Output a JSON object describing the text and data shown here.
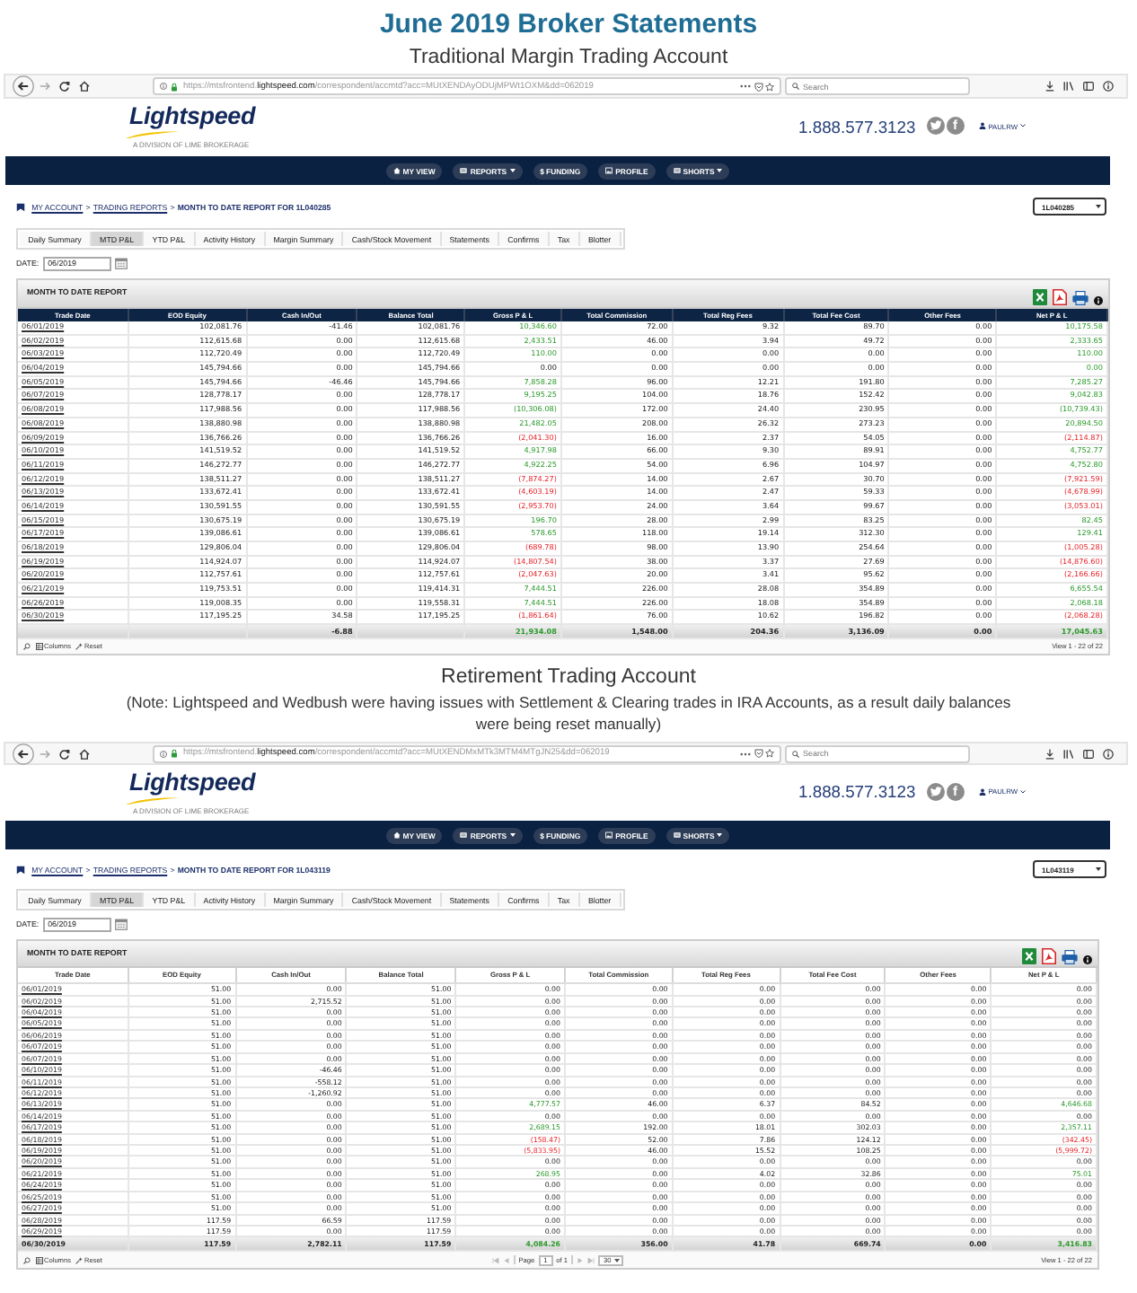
{
  "page_title": "June 2019 Broker Statements",
  "sections": [
    {
      "heading": "Traditional Margin Trading Account",
      "browser": {
        "url": "https://mtsfrontend.**lightspeed.com**/correspondent/accmtd?acc=MUtXENDAyODUjMPWt1OXM&dd=062019",
        "search_placeholder": "Search"
      },
      "site": {
        "logo": "Lightspeed",
        "tagline": "A DIVISION OF LIME BROKERAGE",
        "phone": "1.888.577.3123",
        "social_letter": "f",
        "user": "PAULRW"
      },
      "nav": [
        {
          "label": "MY VIEW",
          "kind": "home",
          "dropdown": false
        },
        {
          "label": "REPORTS",
          "kind": "card",
          "dropdown": true
        },
        {
          "label": "$ FUNDING",
          "kind": "plain",
          "dropdown": false
        },
        {
          "label": "PROFILE",
          "kind": "picture",
          "dropdown": false
        },
        {
          "label": "SHORTS",
          "kind": "card",
          "dropdown": true
        }
      ],
      "breadcrumb": [
        {
          "text": "MY ACCOUNT",
          "kind": "link"
        },
        {
          "text": ">",
          "kind": "separator"
        },
        {
          "text": "TRADING REPORTS",
          "kind": "link"
        },
        {
          "text": ">",
          "kind": "separator"
        },
        {
          "text": "MONTH TO DATE REPORT FOR 1L040285",
          "kind": "current"
        }
      ],
      "account": "1L040285",
      "tabs": [
        {
          "label": "Daily Summary",
          "selected": false
        },
        {
          "label": "MTD P&L",
          "selected": true
        },
        {
          "label": "YTD P&L",
          "selected": false
        },
        {
          "label": "Activity History",
          "selected": false
        },
        {
          "label": "Margin Summary",
          "selected": false
        },
        {
          "label": "Cash/Stock Movement",
          "selected": false
        },
        {
          "label": "Statements",
          "selected": false
        },
        {
          "label": "Confirms",
          "selected": false
        },
        {
          "label": "Tax",
          "selected": false
        },
        {
          "label": "Blotter",
          "selected": false
        }
      ],
      "date": {
        "label": "DATE:",
        "value": "06/2019"
      },
      "report": {
        "title": "MONTH TO DATE REPORT",
        "dark_header": true,
        "columns": [
          "Trade Date",
          "EOD Equity",
          "Cash In/Out",
          "Balance Total",
          "Gross P & L",
          "Total Commission",
          "Total Reg Fees",
          "Total Fee Cost",
          "Other Fees",
          "Net P & L"
        ],
        "rows": [
          {
            "cells": [
              "06/01/2019",
              "102,081.76",
              "-41.46",
              "102,081.76",
              {
                "text": "10,346.60",
                "gain": true
              },
              "72.00",
              "9.32",
              "89.70",
              "0.00",
              {
                "text": "10,175.58",
                "gain": true
              }
            ]
          },
          {
            "cells": [
              "06/02/2019",
              "112,615.68",
              "0.00",
              "112,615.68",
              {
                "text": "2,433.51",
                "gain": true
              },
              "46.00",
              "3.94",
              "49.72",
              "0.00",
              {
                "text": "2,333.65",
                "gain": true
              }
            ]
          },
          {
            "cells": [
              "06/03/2019",
              "112,720.49",
              "0.00",
              "112,720.49",
              {
                "text": "110.00",
                "gain": true
              },
              "0.00",
              "0.00",
              "0.00",
              "0.00",
              {
                "text": "110.00",
                "gain": true
              }
            ]
          },
          {
            "cells": [
              "06/04/2019",
              "145,794.66",
              "0.00",
              "145,794.66",
              "0.00",
              "0.00",
              "0.00",
              "0.00",
              "0.00",
              {
                "text": "0.00",
                "gain": true
              }
            ]
          },
          {
            "cells": [
              "06/05/2019",
              "145,794.66",
              "-46.46",
              "145,794.66",
              {
                "text": "7,858.28",
                "gain": true
              },
              "96.00",
              "12.21",
              "191.80",
              "0.00",
              {
                "text": "7,285.27",
                "gain": true
              }
            ]
          },
          {
            "cells": [
              "06/07/2019",
              "128,778.17",
              "0.00",
              "128,778.17",
              {
                "text": "9,195.25",
                "gain": true
              },
              "104.00",
              "18.76",
              "152.42",
              "0.00",
              {
                "text": "9,042.83",
                "gain": true
              }
            ]
          },
          {
            "cells": [
              "06/08/2019",
              "117,988.56",
              "0.00",
              "117,988.56",
              {
                "text": "(10,306.08)",
                "gain": true
              },
              "172.00",
              "24.40",
              "230.95",
              "0.00",
              {
                "text": "(10,739.43)",
                "gain": true
              }
            ]
          },
          {
            "cells": [
              "06/08/2019",
              "138,880.98",
              "0.00",
              "138,880.98",
              {
                "text": "21,482.05",
                "gain": true
              },
              "208.00",
              "26.32",
              "273.23",
              "0.00",
              {
                "text": "20,894.50",
                "gain": true
              }
            ]
          },
          {
            "cells": [
              "06/09/2019",
              "136,766.26",
              "0.00",
              "136,766.26",
              {
                "text": "(2,041.30)",
                "gain": false
              },
              "16.00",
              "2.37",
              "54.05",
              "0.00",
              {
                "text": "(2,114.87)",
                "gain": false
              }
            ]
          },
          {
            "cells": [
              "06/10/2019",
              "141,519.52",
              "0.00",
              "141,519.52",
              {
                "text": "4,917.98",
                "gain": true
              },
              "66.00",
              "9.30",
              "89.91",
              "0.00",
              {
                "text": "4,752.77",
                "gain": true
              }
            ]
          },
          {
            "cells": [
              "06/11/2019",
              "146,272.77",
              "0.00",
              "146,272.77",
              {
                "text": "4,922.25",
                "gain": true
              },
              "54.00",
              "6.96",
              "104.97",
              "0.00",
              {
                "text": "4,752.80",
                "gain": true
              }
            ]
          },
          {
            "cells": [
              "06/12/2019",
              "138,511.27",
              "0.00",
              "138,511.27",
              {
                "text": "(7,874.27)",
                "gain": false
              },
              "14.00",
              "2.67",
              "30.70",
              "0.00",
              {
                "text": "(7,921.59)",
                "gain": false
              }
            ]
          },
          {
            "cells": [
              "06/13/2019",
              "133,672.41",
              "0.00",
              "133,672.41",
              {
                "text": "(4,603.19)",
                "gain": false
              },
              "14.00",
              "2.47",
              "59.33",
              "0.00",
              {
                "text": "(4,678.99)",
                "gain": false
              }
            ]
          },
          {
            "cells": [
              "06/14/2019",
              "130,591.55",
              "0.00",
              "130,591.55",
              {
                "text": "(2,953.70)",
                "gain": false
              },
              "24.00",
              "3.64",
              "99.67",
              "0.00",
              {
                "text": "(3,053.01)",
                "gain": false
              }
            ]
          },
          {
            "cells": [
              "06/15/2019",
              "130,675.19",
              "0.00",
              "130,675.19",
              {
                "text": "196.70",
                "gain": true
              },
              "28.00",
              "2.99",
              "83.25",
              "0.00",
              {
                "text": "82.45",
                "gain": true
              }
            ]
          },
          {
            "cells": [
              "06/17/2019",
              "139,086.61",
              "0.00",
              "139,086.61",
              {
                "text": "578.65",
                "gain": true
              },
              "118.00",
              "19.14",
              "312.30",
              "0.00",
              {
                "text": "129.41",
                "gain": true
              }
            ]
          },
          {
            "cells": [
              "06/18/2019",
              "129,806.04",
              "0.00",
              "129,806.04",
              {
                "text": "(689.78)",
                "gain": false
              },
              "98.00",
              "13.90",
              "254.64",
              "0.00",
              {
                "text": "(1,005.28)",
                "gain": false
              }
            ]
          },
          {
            "cells": [
              "06/19/2019",
              "114,924.07",
              "0.00",
              "114,924.07",
              {
                "text": "(14,807.54)",
                "gain": false
              },
              "38.00",
              "3.37",
              "27.69",
              "0.00",
              {
                "text": "(14,876.60)",
                "gain": false
              }
            ]
          },
          {
            "cells": [
              "06/20/2019",
              "112,757.61",
              "0.00",
              "112,757.61",
              {
                "text": "(2,047.63)",
                "gain": false
              },
              "20.00",
              "3.41",
              "95.62",
              "0.00",
              {
                "text": "(2,166.66)",
                "gain": false
              }
            ]
          },
          {
            "cells": [
              "06/21/2019",
              "119,753.51",
              "0.00",
              "119,414.31",
              {
                "text": "7,444.51",
                "gain": true
              },
              "226.00",
              "28.08",
              "354.89",
              "0.00",
              {
                "text": "6,655.54",
                "gain": true
              }
            ]
          },
          {
            "cells": [
              "06/26/2019",
              "119,008.35",
              "0.00",
              "119,558.31",
              {
                "text": "7,444.51",
                "gain": true
              },
              "226.00",
              "18.08",
              "354.89",
              "0.00",
              {
                "text": "2,068.18",
                "gain": true
              }
            ]
          },
          {
            "cells": [
              "06/30/2019",
              "117,195.25",
              "34.58",
              "117,195.25",
              {
                "text": "(1,861.64)",
                "gain": false
              },
              "76.00",
              "10.62",
              "196.82",
              "0.00",
              {
                "text": "(2,068.28)",
                "gain": false
              }
            ]
          }
        ],
        "total": {
          "cells": [
            null,
            null,
            "-6.88",
            null,
            {
              "text": "21,934.08",
              "gain": true
            },
            "1,548.00",
            "204.36",
            "3,136.09",
            "0.00",
            {
              "text": "17,045.63",
              "gain": true
            }
          ]
        },
        "footer": {
          "columns_label": "Columns",
          "reset_label": "Reset",
          "view": "View 1 - 22 of 22"
        }
      }
    },
    {
      "heading": "Retirement Trading Account",
      "note": "(Note: Lightspeed and Wedbush were having issues with Settlement & Clearing trades in IRA Accounts, as a result daily balances were being reset manually)",
      "browser": {
        "url": "https://mtsfrontend.**lightspeed.com**/correspondent/accmtd?acc=MUtXENDMxMTk3MTM4MTgJN25&dd=062019",
        "search_placeholder": "Search"
      },
      "site": {
        "logo": "Lightspeed",
        "tagline": "A DIVISION OF LIME BROKERAGE",
        "phone": "1.888.577.3123",
        "social_letter": "f",
        "user": "PAULRW"
      },
      "nav": [
        {
          "label": "MY VIEW",
          "kind": "home",
          "dropdown": false
        },
        {
          "label": "REPORTS",
          "kind": "card",
          "dropdown": true
        },
        {
          "label": "$ FUNDING",
          "kind": "plain",
          "dropdown": false
        },
        {
          "label": "PROFILE",
          "kind": "picture",
          "dropdown": false
        },
        {
          "label": "SHORTS",
          "kind": "card",
          "dropdown": true
        }
      ],
      "breadcrumb": [
        {
          "text": "MY ACCOUNT",
          "kind": "link"
        },
        {
          "text": ">",
          "kind": "separator"
        },
        {
          "text": "TRADING REPORTS",
          "kind": "link"
        },
        {
          "text": ">",
          "kind": "separator"
        },
        {
          "text": "MONTH TO DATE REPORT FOR 1L043119",
          "kind": "current"
        }
      ],
      "account": "1L043119",
      "tabs": [
        {
          "label": "Daily Summary",
          "selected": false
        },
        {
          "label": "MTD P&L",
          "selected": true
        },
        {
          "label": "YTD P&L",
          "selected": false
        },
        {
          "label": "Activity History",
          "selected": false
        },
        {
          "label": "Margin Summary",
          "selected": false
        },
        {
          "label": "Cash/Stock Movement",
          "selected": false
        },
        {
          "label": "Statements",
          "selected": false
        },
        {
          "label": "Confirms",
          "selected": false
        },
        {
          "label": "Tax",
          "selected": false
        },
        {
          "label": "Blotter",
          "selected": false
        }
      ],
      "date": {
        "label": "DATE:",
        "value": "06/2019"
      },
      "report": {
        "title": "MONTH TO DATE REPORT",
        "dark_header": false,
        "columns": [
          "Trade Date",
          "EOD Equity",
          "Cash In/Out",
          "Balance Total",
          "Gross P & L",
          "Total Commission",
          "Total Reg Fees",
          "Total Fee Cost",
          "Other Fees",
          "Net P & L"
        ],
        "rows": [
          {
            "cells": [
              "06/01/2019",
              "51.00",
              "0.00",
              "51.00",
              "0.00",
              "0.00",
              "0.00",
              "0.00",
              "0.00",
              "0.00"
            ]
          },
          {
            "cells": [
              "06/02/2019",
              "51.00",
              "2,715.52",
              "51.00",
              "0.00",
              "0.00",
              "0.00",
              "0.00",
              "0.00",
              "0.00"
            ]
          },
          {
            "cells": [
              "06/04/2019",
              "51.00",
              "0.00",
              "51.00",
              "0.00",
              "0.00",
              "0.00",
              "0.00",
              "0.00",
              "0.00"
            ]
          },
          {
            "cells": [
              "06/05/2019",
              "51.00",
              "0.00",
              "51.00",
              "0.00",
              "0.00",
              "0.00",
              "0.00",
              "0.00",
              "0.00"
            ]
          },
          {
            "cells": [
              "06/06/2019",
              "51.00",
              "0.00",
              "51.00",
              "0.00",
              "0.00",
              "0.00",
              "0.00",
              "0.00",
              "0.00"
            ]
          },
          {
            "cells": [
              "06/07/2019",
              "51.00",
              "0.00",
              "51.00",
              "0.00",
              "0.00",
              "0.00",
              "0.00",
              "0.00",
              "0.00"
            ]
          },
          {
            "cells": [
              "06/07/2019",
              "51.00",
              "0.00",
              "51.00",
              "0.00",
              "0.00",
              "0.00",
              "0.00",
              "0.00",
              "0.00"
            ]
          },
          {
            "cells": [
              "06/10/2019",
              "51.00",
              "-46.46",
              "51.00",
              "0.00",
              "0.00",
              "0.00",
              "0.00",
              "0.00",
              "0.00"
            ]
          },
          {
            "cells": [
              "06/11/2019",
              "51.00",
              "-558.12",
              "51.00",
              "0.00",
              "0.00",
              "0.00",
              "0.00",
              "0.00",
              "0.00"
            ]
          },
          {
            "cells": [
              "06/12/2019",
              "51.00",
              "-1,260.92",
              "51.00",
              "0.00",
              "0.00",
              "0.00",
              "0.00",
              "0.00",
              "0.00"
            ]
          },
          {
            "cells": [
              "06/13/2019",
              "51.00",
              "0.00",
              "51.00",
              {
                "text": "4,777.57",
                "gain": true
              },
              "46.00",
              "6.37",
              "84.52",
              "0.00",
              {
                "text": "4,646.68",
                "gain": true
              }
            ]
          },
          {
            "cells": [
              "06/14/2019",
              "51.00",
              "0.00",
              "51.00",
              "0.00",
              "0.00",
              "0.00",
              "0.00",
              "0.00",
              "0.00"
            ]
          },
          {
            "cells": [
              "06/17/2019",
              "51.00",
              "0.00",
              "51.00",
              {
                "text": "2,689.15",
                "gain": true
              },
              "192.00",
              "18.01",
              "302.03",
              "0.00",
              {
                "text": "2,357.11",
                "gain": true
              }
            ]
          },
          {
            "cells": [
              "06/18/2019",
              "51.00",
              "0.00",
              "51.00",
              {
                "text": "(158.47)",
                "gain": false
              },
              "52.00",
              "7.86",
              "124.12",
              "0.00",
              {
                "text": "(342.45)",
                "gain": false
              }
            ]
          },
          {
            "cells": [
              "06/19/2019",
              "51.00",
              "0.00",
              "51.00",
              {
                "text": "(5,833.95)",
                "gain": false
              },
              "46.00",
              "15.52",
              "108.25",
              "0.00",
              {
                "text": "(5,999.72)",
                "gain": false
              }
            ]
          },
          {
            "cells": [
              "06/20/2019",
              "51.00",
              "0.00",
              "51.00",
              "0.00",
              "0.00",
              "0.00",
              "0.00",
              "0.00",
              "0.00"
            ]
          },
          {
            "cells": [
              "06/21/2019",
              "51.00",
              "0.00",
              "51.00",
              {
                "text": "268.95",
                "gain": true
              },
              "0.00",
              "4.02",
              "32.86",
              "0.00",
              {
                "text": "75.01",
                "gain": true
              }
            ]
          },
          {
            "cells": [
              "06/24/2019",
              "51.00",
              "0.00",
              "51.00",
              "0.00",
              "0.00",
              "0.00",
              "0.00",
              "0.00",
              "0.00"
            ]
          },
          {
            "cells": [
              "06/25/2019",
              "51.00",
              "0.00",
              "51.00",
              "0.00",
              "0.00",
              "0.00",
              "0.00",
              "0.00",
              "0.00"
            ]
          },
          {
            "cells": [
              "06/27/2019",
              "51.00",
              "0.00",
              "51.00",
              "0.00",
              "0.00",
              "0.00",
              "0.00",
              "0.00",
              "0.00"
            ]
          },
          {
            "cells": [
              "06/28/2019",
              "117.59",
              "66.59",
              "117.59",
              "0.00",
              "0.00",
              "0.00",
              "0.00",
              "0.00",
              "0.00"
            ]
          },
          {
            "cells": [
              "06/29/2019",
              "117.59",
              "0.00",
              "117.59",
              "0.00",
              "0.00",
              "0.00",
              "0.00",
              "0.00",
              "0.00"
            ]
          }
        ],
        "total": {
          "cells": [
            "06/30/2019",
            "117.59",
            "2,782.11",
            "117.59",
            {
              "text": "4,084.26",
              "gain": true
            },
            "356.00",
            "41.78",
            "669.74",
            "0.00",
            {
              "text": "3,416.83",
              "gain": true
            }
          ]
        },
        "footer": {
          "columns_label": "Columns",
          "reset_label": "Reset",
          "pager": {
            "page_label": "Page",
            "page": "1",
            "of_label": "of 1",
            "page_size": "30"
          },
          "view": "View 1 - 22 of 22"
        }
      }
    }
  ]
}
